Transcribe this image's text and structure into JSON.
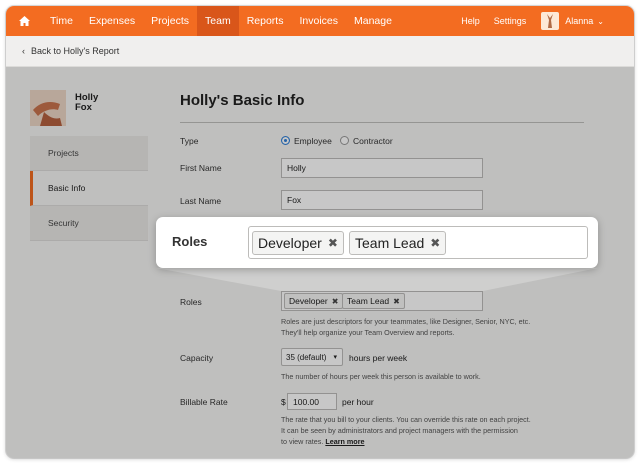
{
  "nav": {
    "items": [
      "Time",
      "Expenses",
      "Projects",
      "Team",
      "Reports",
      "Invoices",
      "Manage"
    ],
    "active": "Team",
    "help": "Help",
    "settings": "Settings",
    "user": "Alanna",
    "accent": "#f36c21"
  },
  "back_link": "Back to Holly's Report",
  "profile": {
    "first": "Holly",
    "last": "Fox"
  },
  "sidebar": {
    "items": [
      "Projects",
      "Basic Info",
      "Security"
    ],
    "active": "Basic Info"
  },
  "page_title": "Holly's Basic Info",
  "form": {
    "type_label": "Type",
    "type_options": [
      "Employee",
      "Contractor"
    ],
    "type_selected": "Employee",
    "first_name_label": "First Name",
    "first_name": "Holly",
    "last_name_label": "Last Name",
    "last_name": "Fox",
    "roles_label": "Roles",
    "roles": [
      "Developer",
      "Team Lead"
    ],
    "roles_help_1": "Roles are just descriptors for your teammates, like Designer, Senior, NYC, etc.",
    "roles_help_2": "They'll help organize your Team Overview and reports.",
    "capacity_label": "Capacity",
    "capacity_value": "35 (default)",
    "capacity_unit": "hours per week",
    "capacity_help": "The number of hours per week this person is available to work.",
    "rate_label": "Billable Rate",
    "currency": "$",
    "rate_value": "100.00",
    "rate_unit": "per hour",
    "rate_help_1": "The rate that you bill to your clients. You can override this rate on each project.",
    "rate_help_2": "It can be seen by administrators and project managers with the permission",
    "rate_help_3": "to view rates.",
    "learn_more": "Learn more"
  },
  "callout": {
    "label": "Roles",
    "roles": [
      "Developer",
      "Team Lead"
    ]
  }
}
